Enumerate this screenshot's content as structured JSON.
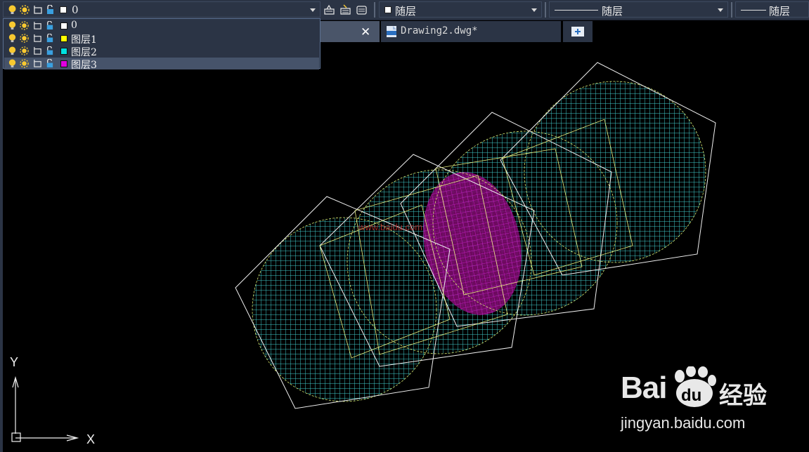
{
  "toolbar": {
    "current_layer": "0",
    "current_layer_color": "#ffffff",
    "color_value": "随层",
    "linetype_value": "随层",
    "lineweight_value": "随层"
  },
  "layers": [
    {
      "name": "0",
      "color": "#ffffff"
    },
    {
      "name": "图层1",
      "color": "#ffff00"
    },
    {
      "name": "图层2",
      "color": "#00e0e0"
    },
    {
      "name": "图层3",
      "color": "#e000e0"
    }
  ],
  "tabs": {
    "tab2_label": "Drawing2.dwg*"
  },
  "ucs": {
    "x_label": "X",
    "y_label": "Y"
  },
  "canvas_watermark": "www.baidu.com",
  "watermark": {
    "brand": "Bai",
    "paw_text": "du",
    "product": "经验",
    "url": "jingyan.baidu.com"
  },
  "colors": {
    "hatch": "#3fc8c8",
    "highlight": "#c000c0",
    "outline": "#f0f0f0",
    "circle": "#e8f060"
  }
}
